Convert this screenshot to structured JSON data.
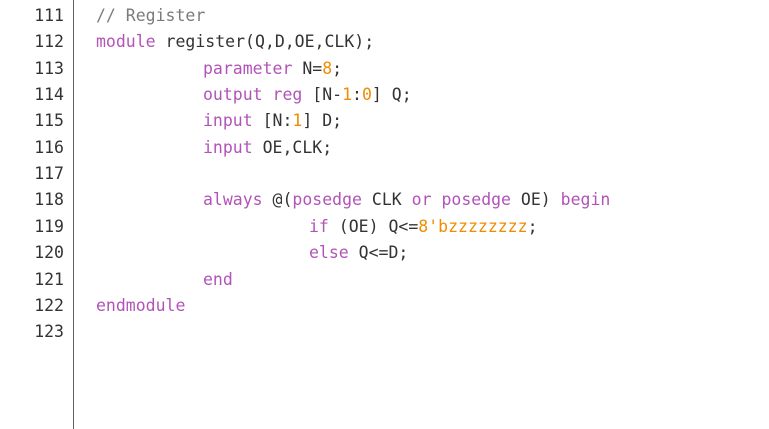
{
  "colors": {
    "comment": "#7b7b7b",
    "keyword": "#b253b8",
    "number": "#f08c00",
    "plain": "#333333"
  },
  "lines": [
    {
      "number": "111",
      "indent": 0,
      "tokens": [
        {
          "text": "// Register",
          "type": "comment"
        }
      ]
    },
    {
      "number": "112",
      "indent": 0,
      "tokens": [
        {
          "text": "module",
          "type": "keyword"
        },
        {
          "text": " register(Q,D,OE,CLK);",
          "type": "plain"
        }
      ]
    },
    {
      "number": "113",
      "indent": 1,
      "tokens": [
        {
          "text": "parameter",
          "type": "keyword"
        },
        {
          "text": " N=",
          "type": "plain"
        },
        {
          "text": "8",
          "type": "number"
        },
        {
          "text": ";",
          "type": "plain"
        }
      ]
    },
    {
      "number": "114",
      "indent": 1,
      "tokens": [
        {
          "text": "output",
          "type": "keyword"
        },
        {
          "text": " ",
          "type": "plain"
        },
        {
          "text": "reg",
          "type": "keyword"
        },
        {
          "text": " [N-",
          "type": "plain"
        },
        {
          "text": "1",
          "type": "number"
        },
        {
          "text": ":",
          "type": "plain"
        },
        {
          "text": "0",
          "type": "number"
        },
        {
          "text": "] Q;",
          "type": "plain"
        }
      ]
    },
    {
      "number": "115",
      "indent": 1,
      "tokens": [
        {
          "text": "input",
          "type": "keyword"
        },
        {
          "text": " [N:",
          "type": "plain"
        },
        {
          "text": "1",
          "type": "number"
        },
        {
          "text": "] D;",
          "type": "plain"
        }
      ]
    },
    {
      "number": "116",
      "indent": 1,
      "tokens": [
        {
          "text": "input",
          "type": "keyword"
        },
        {
          "text": " OE,CLK;",
          "type": "plain"
        }
      ]
    },
    {
      "number": "117",
      "indent": 0,
      "tokens": []
    },
    {
      "number": "118",
      "indent": 1,
      "tokens": [
        {
          "text": "always",
          "type": "keyword"
        },
        {
          "text": " @(",
          "type": "plain"
        },
        {
          "text": "posedge",
          "type": "keyword"
        },
        {
          "text": " CLK ",
          "type": "plain"
        },
        {
          "text": "or",
          "type": "keyword"
        },
        {
          "text": " ",
          "type": "plain"
        },
        {
          "text": "posedge",
          "type": "keyword"
        },
        {
          "text": " OE) ",
          "type": "plain"
        },
        {
          "text": "begin",
          "type": "keyword"
        }
      ]
    },
    {
      "number": "119",
      "indent": 2,
      "tokens": [
        {
          "text": "if",
          "type": "keyword"
        },
        {
          "text": " (OE) Q<=",
          "type": "plain"
        },
        {
          "text": "8'bzzzzzzzz",
          "type": "number"
        },
        {
          "text": ";",
          "type": "plain"
        }
      ]
    },
    {
      "number": "120",
      "indent": 2,
      "tokens": [
        {
          "text": "else",
          "type": "keyword"
        },
        {
          "text": " Q<=D;",
          "type": "plain"
        }
      ]
    },
    {
      "number": "121",
      "indent": 1,
      "tokens": [
        {
          "text": "end",
          "type": "keyword"
        }
      ]
    },
    {
      "number": "122",
      "indent": 0,
      "tokens": [
        {
          "text": "endmodule",
          "type": "keyword"
        }
      ]
    },
    {
      "number": "123",
      "indent": 0,
      "tokens": []
    }
  ]
}
